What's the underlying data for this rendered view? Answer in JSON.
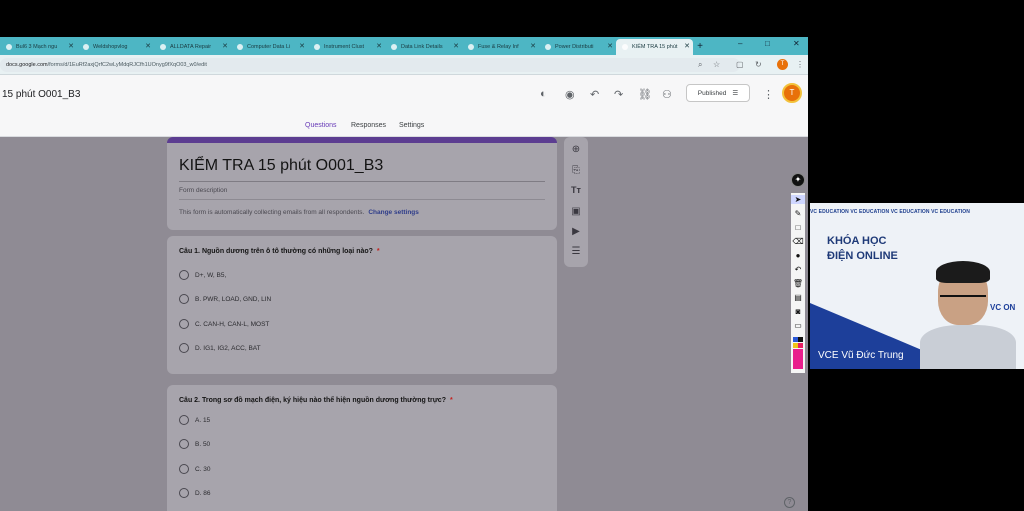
{
  "browser": {
    "tabs": [
      {
        "label": "Bul6 3 Mạch ngu"
      },
      {
        "label": "Weldshopvlog"
      },
      {
        "label": "ALLDATA Repair"
      },
      {
        "label": "Computer Data Li"
      },
      {
        "label": "Instrument Clust"
      },
      {
        "label": "Data Link Details"
      },
      {
        "label": "Fuse & Relay Inf"
      },
      {
        "label": "Power Distributi"
      },
      {
        "label": "KIỂM TRA 15 phút"
      }
    ],
    "new_tab": "+",
    "window_controls": {
      "minimize": "–",
      "maximize": "□",
      "close": "✕"
    },
    "url_host": "docs.google.com",
    "url_path": "/forms/d/1EuRf2axjQrfC2wLyMdqRJCfh1UOnyg9fXqO03_w0/edit",
    "profile_initial": "T"
  },
  "form_app": {
    "doc_title": "15 phút O001_B3",
    "published_label": "Published",
    "avatar_initial": "T",
    "tabs": [
      {
        "label": "Questions",
        "active": true
      },
      {
        "label": "Responses",
        "active": false
      },
      {
        "label": "Settings",
        "active": false
      }
    ]
  },
  "form": {
    "title": "KIỂM TRA 15 phút O001_B3",
    "description_placeholder": "Form description",
    "email_note": "This form is automatically collecting emails from all respondents.",
    "change_settings": "Change settings"
  },
  "questions": [
    {
      "text": "Câu 1. Nguồn dương trên ô tô thường có những loại nào?",
      "required_mark": "*",
      "options": [
        "D+, W, B5,",
        "B. PWR, LOAD, GND, LIN",
        "C. CAN-H, CAN-L, MOST",
        "D. IG1, IG2, ACC, BAT"
      ]
    },
    {
      "text": "Câu 2.  Trong sơ đồ mạch điện, ký hiệu nào thể hiện nguồn dương thường trực?",
      "required_mark": "*",
      "options": [
        "A. 15",
        "B. 50",
        "C. 30",
        "D. 86"
      ]
    }
  ],
  "webcam": {
    "banner": "VC EDUCATION  VC EDUCATION  VC EDUCATION  VC EDUCATION",
    "headline_1": "KHÓA HỌC",
    "headline_2": "ĐIỆN ONLINE",
    "logo_text": "VC   ON",
    "presenter_name": "VCE Vũ Đức Trung"
  },
  "colors": {
    "accent": "#673ab7",
    "tabbar": "#4db6c4",
    "header_bar": "#5c3d91",
    "required": "#c5221f"
  }
}
